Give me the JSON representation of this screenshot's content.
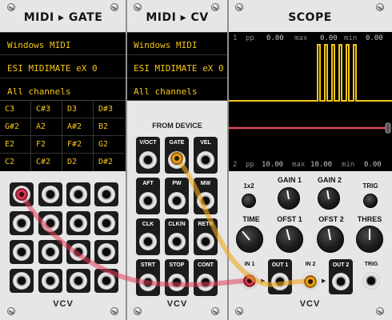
{
  "modules": {
    "midi_gate": {
      "title": "MIDI ▸ GATE",
      "driver": "Windows MIDI",
      "device": "ESI MIDIMATE eX 0",
      "channel": "All channels",
      "notes": [
        "C3",
        "C#3",
        "D3",
        "D#3",
        "G#2",
        "A2",
        "A#2",
        "B2",
        "E2",
        "F2",
        "F#2",
        "G2",
        "C2",
        "C#2",
        "D2",
        "D#2"
      ],
      "logo": "VCV"
    },
    "midi_cv": {
      "title": "MIDI ▸ CV",
      "driver": "Windows MIDI",
      "device": "ESI MIDIMATE eX 0",
      "channel": "All channels",
      "section_label": "FROM DEVICE",
      "ports": [
        "V/OCT",
        "GATE",
        "VEL",
        "AFT",
        "PW",
        "MW",
        "CLK",
        "CLK/N",
        "RETR",
        "STRT",
        "STOP",
        "CONT"
      ],
      "logo": "VCV"
    },
    "scope": {
      "title": "SCOPE",
      "stats_top": {
        "channel": "1",
        "pp_label": "pp",
        "pp": "0.00",
        "max_label": "max",
        "max": "0.00",
        "min_label": "min",
        "min": "0.00"
      },
      "stats_bottom": {
        "channel": "2",
        "pp_label": "pp",
        "pp": "10.00",
        "max_label": "max",
        "max": "10.00",
        "min_label": "min",
        "min": "0.00"
      },
      "labels": {
        "x1x2": "1x2",
        "gain1": "GAIN 1",
        "gain2": "GAIN 2",
        "trig_button": "TRIG",
        "time": "TIME",
        "ofst1": "OFST 1",
        "ofst2": "OFST 2",
        "thres": "THRES"
      },
      "port_labels": {
        "in1": "IN 1",
        "out1": "OUT 1",
        "in2": "IN 2",
        "out2": "OUT 2",
        "trig": "TRIG"
      },
      "logo": "VCV"
    }
  },
  "colors": {
    "lcd_text": "#f5c518",
    "trace_1": "#f5c518",
    "trace_2": "#e0445a",
    "cable_red": "#e0405a",
    "cable_yellow": "#f0a81e"
  }
}
